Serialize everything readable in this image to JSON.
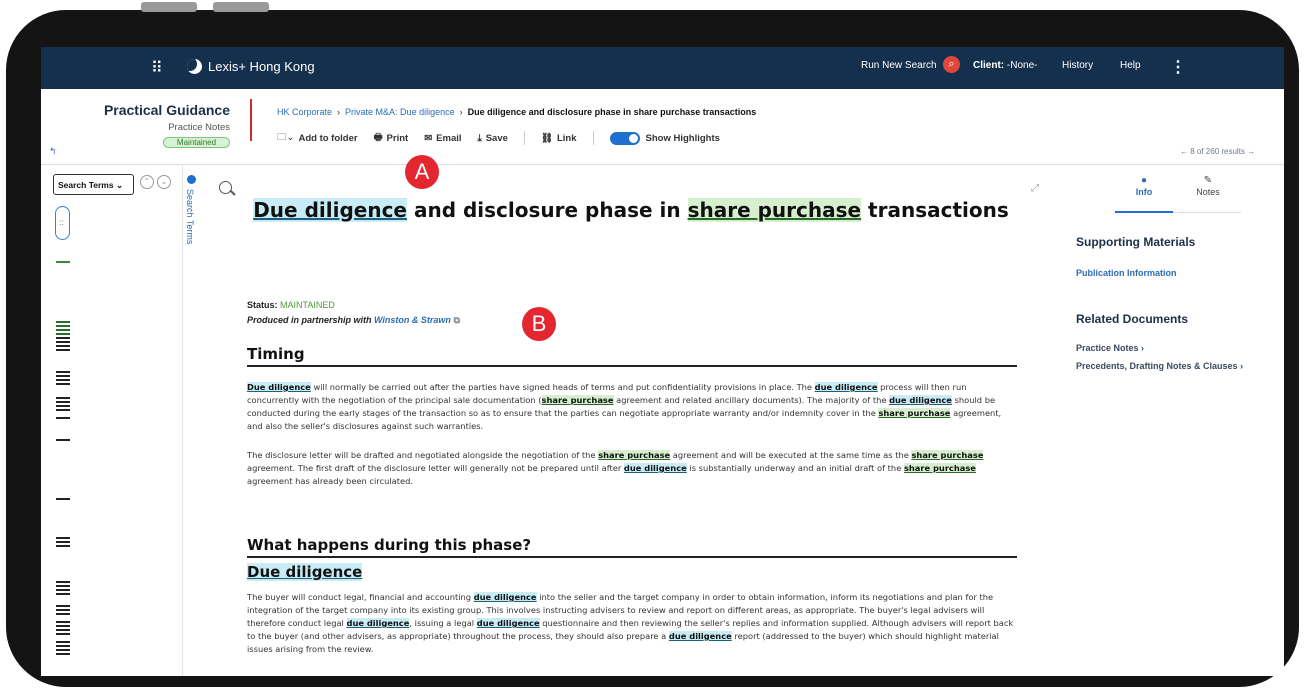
{
  "topbar": {
    "brand": "Lexis+ Hong Kong",
    "run_new_search": "Run New Search",
    "client_label": "Client:",
    "client_value": "-None-",
    "history": "History",
    "help": "Help"
  },
  "header": {
    "title": "Practical Guidance",
    "subtitle": "Practice Notes",
    "badge": "Maintained",
    "breadcrumb": [
      "HK Corporate",
      "Private M&A: Due diligence",
      "Due diligence and disclosure phase in share purchase transactions"
    ],
    "toolbar": {
      "add_to_folder": "Add to folder",
      "print": "Print",
      "email": "Email",
      "save": "Save",
      "link": "Link",
      "show_highlights": "Show Highlights"
    },
    "results": "← 8 of 260 results →"
  },
  "left_panel": {
    "search_terms_select": "Search Terms",
    "vertical_tab": "Search Terms"
  },
  "document": {
    "title_parts": [
      "Due diligence",
      " and disclosure phase in ",
      "share purchase",
      " transactions"
    ],
    "status_label": "Status:",
    "status_value": "MAINTAINED",
    "produced_prefix": "Produced in partnership with ",
    "produced_partner": "Winston & Strawn",
    "timing_heading": "Timing",
    "phase_heading": "What happens during this phase?",
    "dd_heading": "Due diligence"
  },
  "callouts": {
    "a": "A",
    "b": "B"
  },
  "right_panel": {
    "tab_info": "Info",
    "tab_notes": "Notes",
    "supporting_heading": "Supporting Materials",
    "publication_info": "Publication Information",
    "related_heading": "Related Documents",
    "related_items": [
      "Practice Notes",
      "Precedents, Drafting Notes & Clauses"
    ]
  },
  "colors": {
    "topbar": "#15304d",
    "accent": "#1f6fd0",
    "callout": "#e3262f",
    "highlight_blue": "#c7ecf6",
    "highlight_green": "#d6efcf"
  }
}
